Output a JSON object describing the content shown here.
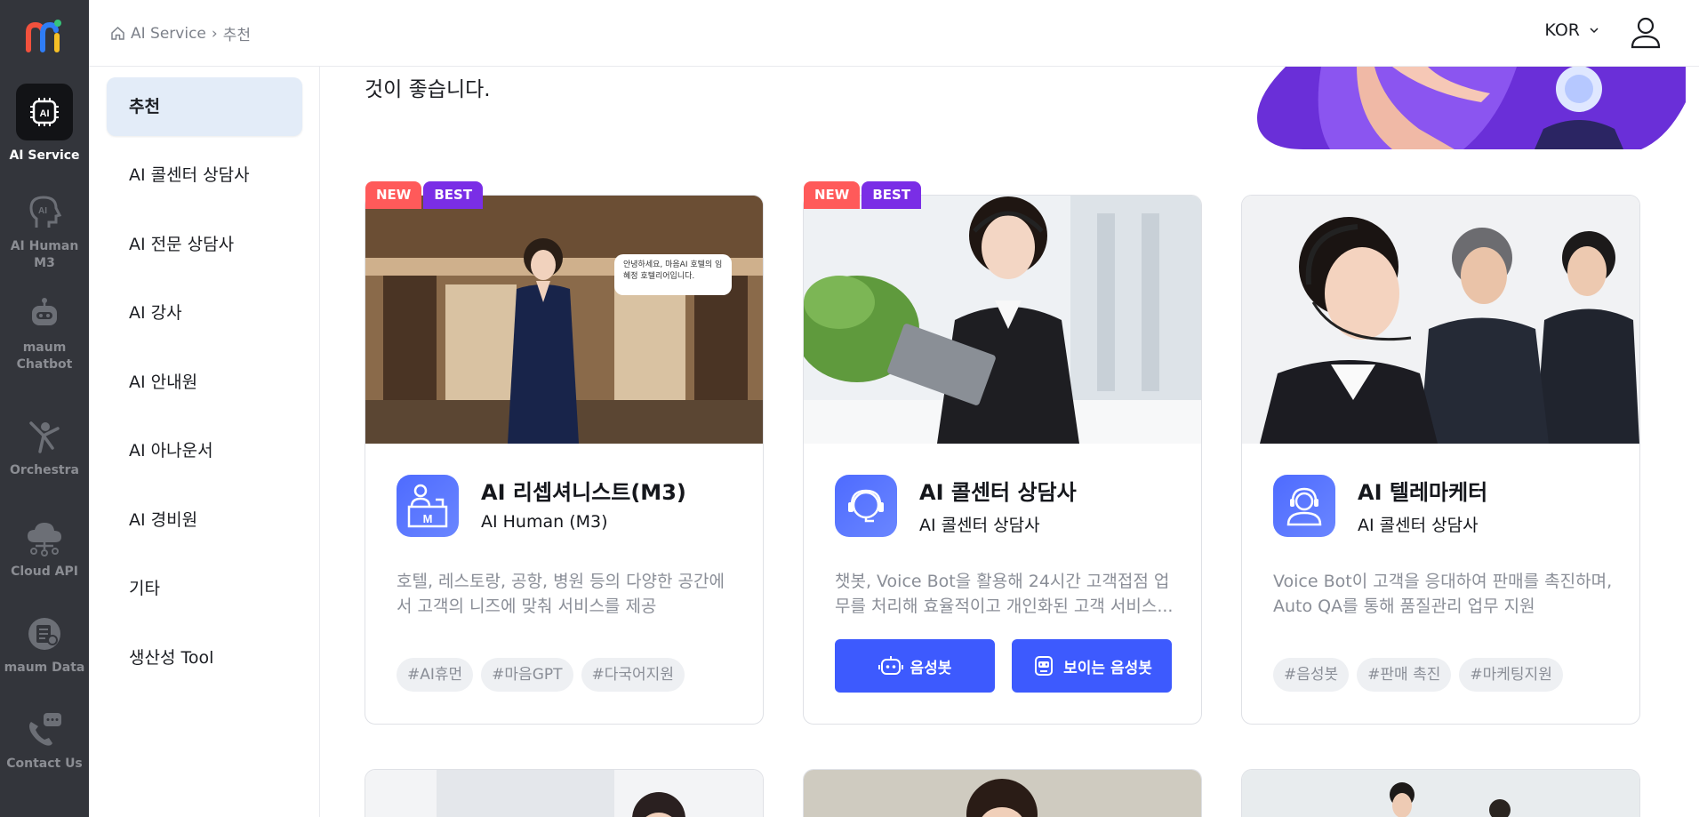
{
  "rail": {
    "items": [
      {
        "label": "AI Service",
        "icon": "ai-chip-icon",
        "active": true
      },
      {
        "label": "AI Human M3",
        "icon": "ai-head-icon"
      },
      {
        "label": "maum\nChatbot",
        "icon": "robot-icon"
      },
      {
        "label": "Orchestra",
        "icon": "conductor-icon"
      },
      {
        "label": "Cloud API",
        "icon": "cloud-icon"
      },
      {
        "label": "maum Data",
        "icon": "data-doc-icon"
      },
      {
        "label": "Contact Us",
        "icon": "phone-chat-icon"
      }
    ]
  },
  "header": {
    "breadcrumb_root": "AI Service",
    "breadcrumb_sep": "›",
    "breadcrumb_current": "추천",
    "language": "KOR"
  },
  "submenu": {
    "items": [
      "추천",
      "AI 콜센터 상담사",
      "AI 전문 상담사",
      "AI 강사",
      "AI 안내원",
      "AI 아나운서",
      "AI 경비원",
      "기타",
      "생산성 Tool"
    ]
  },
  "main": {
    "intro_text": "것이 좋습니다.",
    "cards": [
      {
        "badges": [
          "NEW",
          "BEST"
        ],
        "title": "AI 리셉셔니스트(M3)",
        "subtitle": "AI Human (M3)",
        "desc": "호텔, 레스토랑, 공항, 병원 등의 다양한 공간에서 고객의 니즈에 맞춰 서비스를 제공",
        "tags": [
          "#AI휴먼",
          "#마음GPT",
          "#다국어지원"
        ],
        "speech_bubble": "안녕하세요, 마음AI 호텔의 임혜정 호텔리어입니다."
      },
      {
        "badges": [
          "NEW",
          "BEST"
        ],
        "title": "AI 콜센터 상담사",
        "subtitle": "AI 콜센터 상담사",
        "desc": "챗봇, Voice Bot을 활용해 24시간 고객접점 업무를 처리해 효율적이고 개인화된 고객 서비스...",
        "buttons": [
          "음성봇",
          "보이는 음성봇"
        ]
      },
      {
        "badges": [],
        "title": "AI 텔레마케터",
        "subtitle": "AI 콜센터 상담사",
        "desc": "Voice Bot이 고객을 응대하여 판매를 촉진하며, Auto QA를 통해 품질관리 업무 지원",
        "tags": [
          "#음성봇",
          "#판매 촉진",
          "#마케팅지원"
        ]
      }
    ]
  },
  "colors": {
    "rail_bg": "#33353b",
    "accent_blue": "#3d5afe",
    "badge_new": "#ff5a5a",
    "badge_best": "#7a2ee6",
    "submenu_active": "#e3ecf8"
  }
}
